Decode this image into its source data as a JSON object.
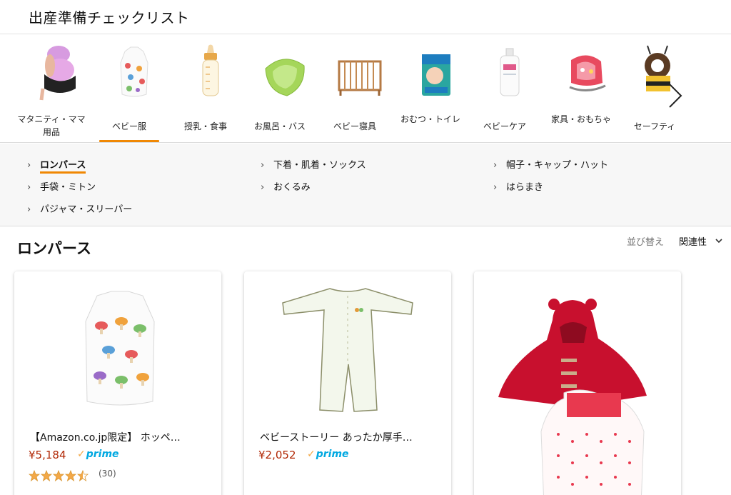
{
  "page": {
    "title": "出産準備チェックリスト"
  },
  "categories": [
    {
      "label": "マタニティ・ママ用品",
      "icon": "maternity-belt-icon"
    },
    {
      "label": "ベビー服",
      "icon": "baby-sleeper-icon",
      "selected": true
    },
    {
      "label": "授乳・食事",
      "icon": "baby-bottle-icon"
    },
    {
      "label": "お風呂・バス",
      "icon": "baby-bathtub-icon"
    },
    {
      "label": "ベビー寝具",
      "icon": "baby-crib-icon"
    },
    {
      "label": "おむつ・トイレ",
      "icon": "diaper-pack-icon"
    },
    {
      "label": "ベビーケア",
      "icon": "lotion-bottle-icon"
    },
    {
      "label": "家具・おもちゃ",
      "icon": "baby-rocker-icon"
    },
    {
      "label": "セーフティ",
      "icon": "bee-head-protector-icon"
    }
  ],
  "subcategories": [
    {
      "label": "ロンパース",
      "active": true
    },
    {
      "label": "下着・肌着・ソックス"
    },
    {
      "label": "帽子・キャップ・ハット"
    },
    {
      "label": "手袋・ミトン"
    },
    {
      "label": "おくるみ"
    },
    {
      "label": "はらまき"
    },
    {
      "label": "パジャマ・スリーパー"
    }
  ],
  "section": {
    "title": "ロンパース",
    "sort_label": "並び替え",
    "sort_value": "関連性"
  },
  "products": [
    {
      "title": "【Amazon.co.jp限定】 ホッペ…",
      "price": "¥5,184",
      "prime": "prime",
      "rating": 4.5,
      "reviews": "(30)"
    },
    {
      "title": "ベビーストーリー あったか厚手…",
      "price": "¥2,052",
      "prime": "prime"
    },
    {
      "title": "",
      "price": "",
      "prime": ""
    }
  ],
  "colors": {
    "accent": "#f08804",
    "price": "#b12704",
    "prime": "#00a8e1",
    "star": "#f3a847"
  }
}
